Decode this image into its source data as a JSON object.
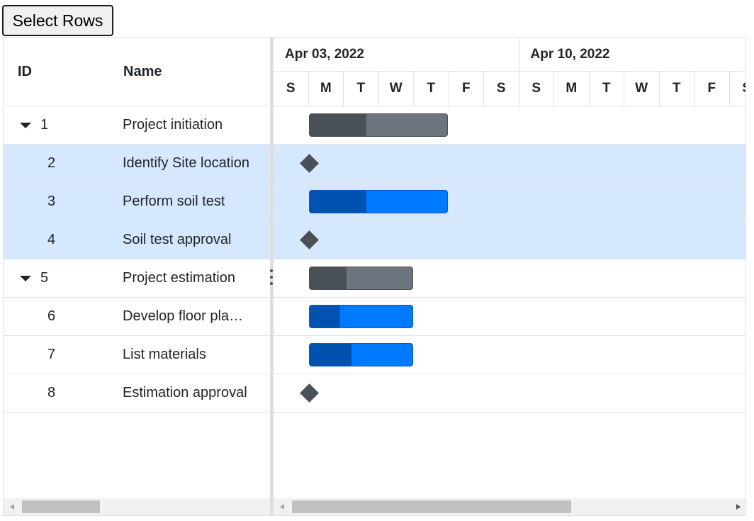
{
  "toolbar": {
    "select_rows_label": "Select Rows"
  },
  "grid": {
    "columns": {
      "id": "ID",
      "name": "Name"
    },
    "rows": [
      {
        "id": "1",
        "name": "Project initiation",
        "parent": true,
        "selected": false
      },
      {
        "id": "2",
        "name": "Identify Site location",
        "parent": false,
        "selected": true
      },
      {
        "id": "3",
        "name": "Perform soil test",
        "parent": false,
        "selected": true
      },
      {
        "id": "4",
        "name": "Soil test approval",
        "parent": false,
        "selected": true
      },
      {
        "id": "5",
        "name": "Project estimation",
        "parent": true,
        "selected": false
      },
      {
        "id": "6",
        "name": "Develop floor pla…",
        "parent": false,
        "selected": false
      },
      {
        "id": "7",
        "name": "List materials",
        "parent": false,
        "selected": false
      },
      {
        "id": "8",
        "name": "Estimation approval",
        "parent": false,
        "selected": false
      }
    ]
  },
  "timeline": {
    "weeks": [
      "Apr 03, 2022",
      "Apr 10, 2022"
    ],
    "days": [
      "S",
      "M",
      "T",
      "W",
      "T",
      "F",
      "S",
      "S",
      "M",
      "T",
      "W",
      "T",
      "F",
      "S"
    ]
  },
  "tasks": [
    {
      "row": 0,
      "kind": "parent",
      "start_day": 1,
      "duration_days": 4,
      "progress": 0.41
    },
    {
      "row": 1,
      "kind": "milestone",
      "start_day": 1
    },
    {
      "row": 2,
      "kind": "child",
      "start_day": 1,
      "duration_days": 4,
      "progress": 0.41
    },
    {
      "row": 3,
      "kind": "milestone",
      "start_day": 1
    },
    {
      "row": 4,
      "kind": "parent",
      "start_day": 1,
      "duration_days": 3,
      "progress": 0.36
    },
    {
      "row": 5,
      "kind": "child",
      "start_day": 1,
      "duration_days": 3,
      "progress": 0.3
    },
    {
      "row": 6,
      "kind": "child",
      "start_day": 1,
      "duration_days": 3,
      "progress": 0.41
    },
    {
      "row": 7,
      "kind": "milestone",
      "start_day": 1
    }
  ],
  "colors": {
    "selected_row": "#d6e8fe",
    "parent_bar": "#6c757d",
    "parent_progress": "#495057",
    "child_bar": "#007bff",
    "child_progress": "#0052b0",
    "milestone": "#495057"
  },
  "scrollbars": {
    "grid_scroll_position": 0.0,
    "chart_scroll_position": 0.0
  }
}
